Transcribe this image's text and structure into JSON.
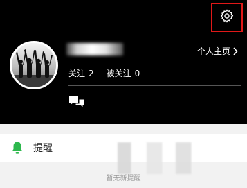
{
  "header": {
    "profile_link_label": "个人主页",
    "stats": {
      "following_label": "关注",
      "following_count": "2",
      "followers_label": "被关注",
      "followers_count": "0"
    }
  },
  "reminder": {
    "label": "提醒",
    "empty_text": "暂无新提醒"
  },
  "icons": {
    "settings": "gear-icon",
    "profile_chevron": "chevron-right-icon",
    "messages": "chat-bubbles-icon",
    "reminder": "bell-icon"
  },
  "colors": {
    "header_bg": "#000000",
    "settings_highlight": "#e01818",
    "accent_green": "#2db84d"
  }
}
